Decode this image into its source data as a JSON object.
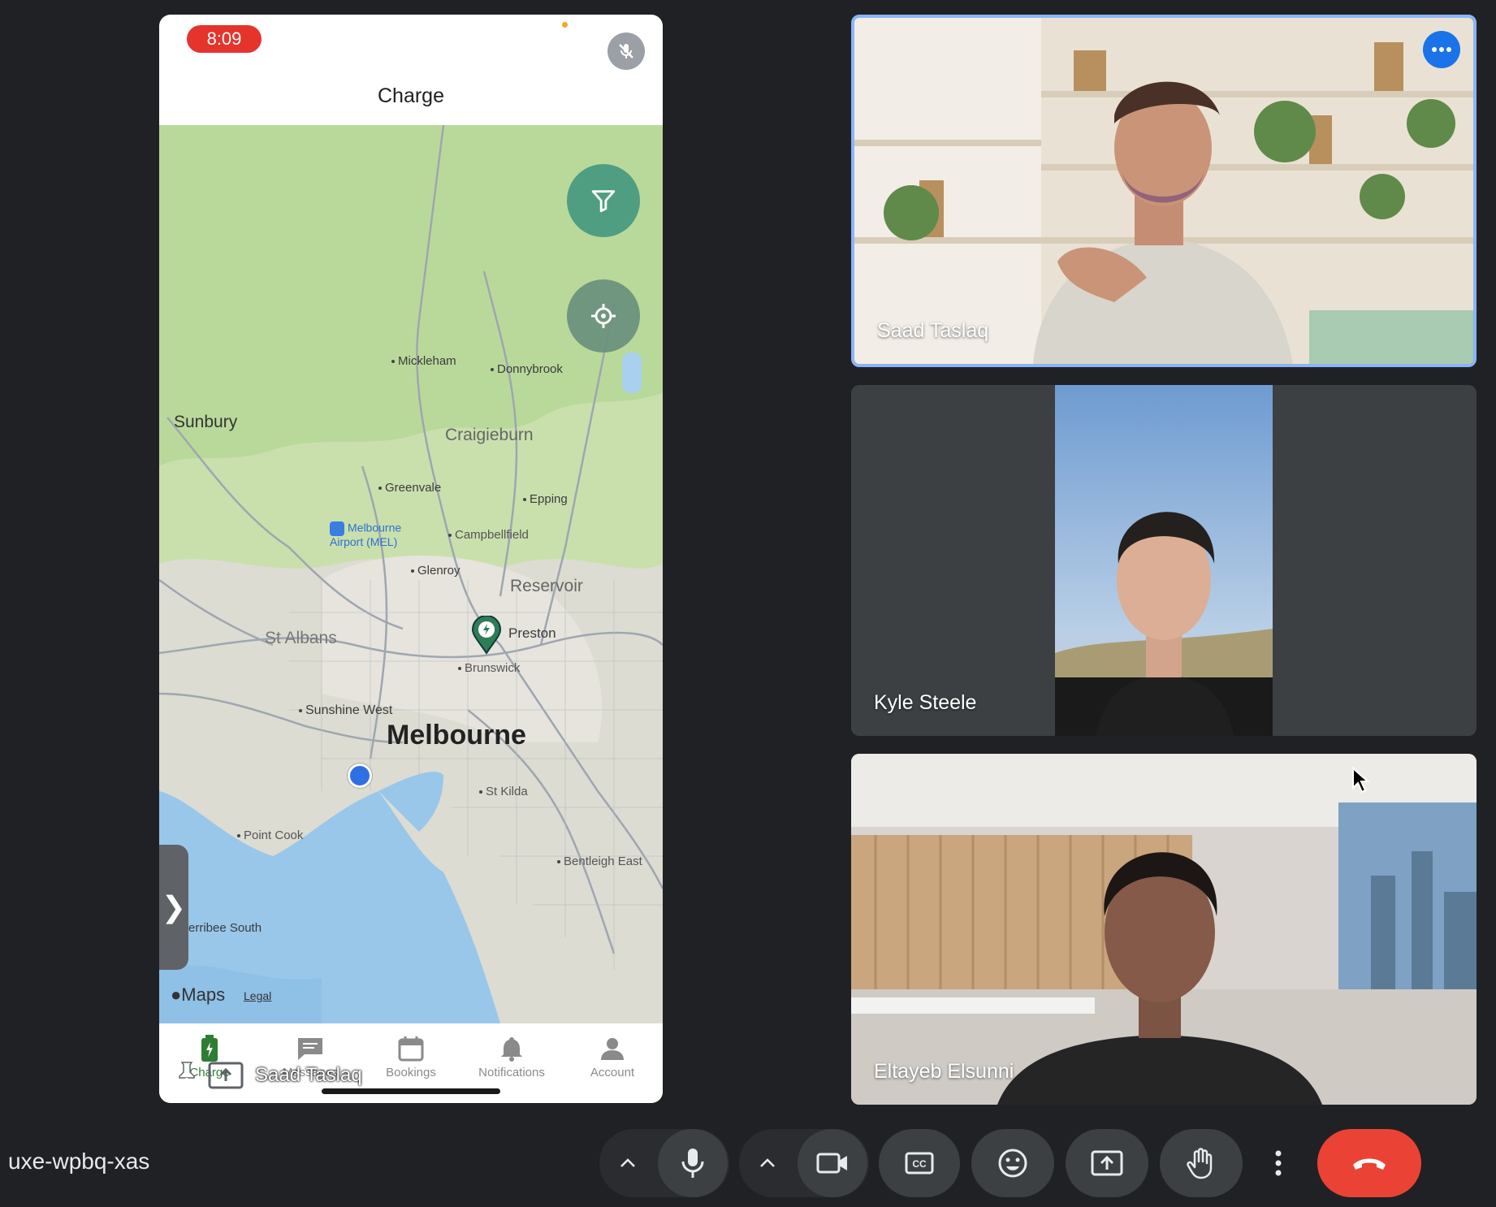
{
  "phone": {
    "status_time": "8:09",
    "title": "Charge",
    "map": {
      "places": {
        "sunbury": "Sunbury",
        "mickleham": "Mickleham",
        "donnybrook": "Donnybrook",
        "craigieburn": "Craigieburn",
        "greenvale": "Greenvale",
        "epping": "Epping",
        "airport": "Melbourne Airport (MEL)",
        "campbellfield": "Campbellfield",
        "glenroy": "Glenroy",
        "reservoir": "Reservoir",
        "preston": "Preston",
        "st_albans": "St Albans",
        "brunswick": "Brunswick",
        "sunshine_west": "Sunshine West",
        "melbourne": "Melbourne",
        "st_kilda": "St Kilda",
        "point_cook": "Point Cook",
        "bentleigh_east": "Bentleigh East",
        "werribee_south": "erribee South"
      },
      "brand": "Maps",
      "legal": "Legal",
      "filter_icon": "filter-icon",
      "locate_icon": "locate-icon"
    },
    "tabs": [
      {
        "label": "Charge",
        "icon": "charge-icon"
      },
      {
        "label": "Messages",
        "icon": "messages-icon"
      },
      {
        "label": "Bookings",
        "icon": "calendar-icon"
      },
      {
        "label": "Notifications",
        "icon": "bell-icon"
      },
      {
        "label": "Account",
        "icon": "person-icon"
      }
    ],
    "presenter_name": "Saad Taslaq"
  },
  "participants": [
    {
      "name": "Saad Taslaq",
      "active_speaker": true
    },
    {
      "name": "Kyle Steele",
      "active_speaker": false
    },
    {
      "name": "Eltayeb Elsunni",
      "active_speaker": false
    }
  ],
  "meeting": {
    "code": "uxe-wpbq-xas"
  },
  "colors": {
    "background": "#202124",
    "control": "#3c4043",
    "end_call": "#ea4335",
    "active_border": "#8ab4f8",
    "charge_green": "#2e7d32"
  }
}
